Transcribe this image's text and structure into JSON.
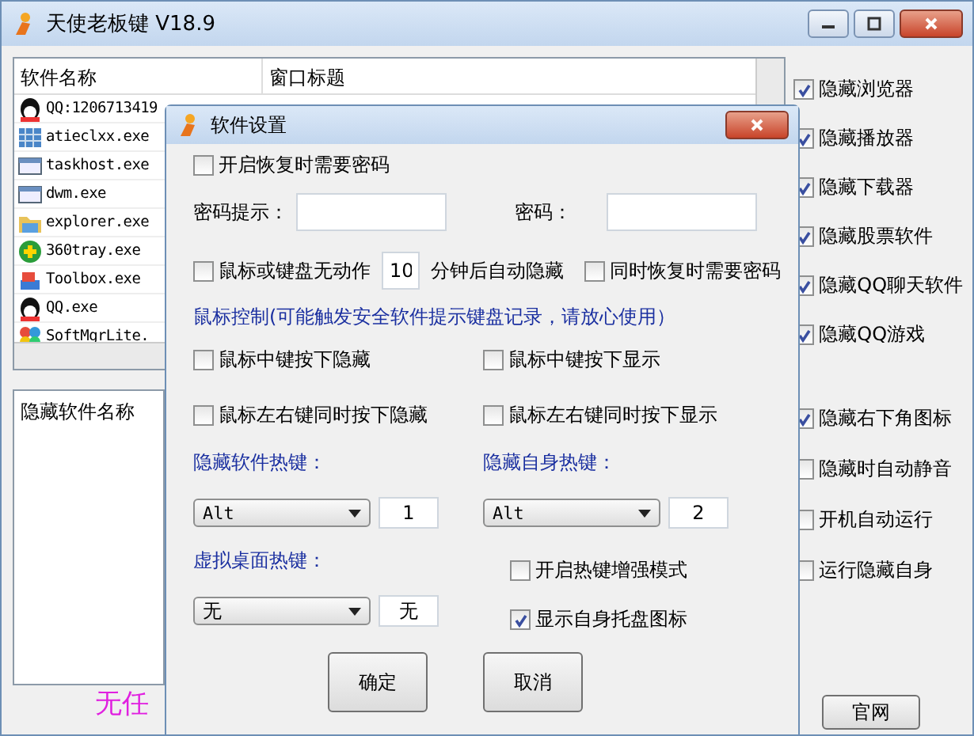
{
  "window": {
    "title": "天使老板键 V18.9"
  },
  "process_list": {
    "columns": [
      "软件名称",
      "窗口标题"
    ],
    "rows": [
      {
        "name": "QQ:1206713419",
        "kind": "penguin"
      },
      {
        "name": "atieclxx.exe",
        "kind": "grid"
      },
      {
        "name": "taskhost.exe",
        "kind": "window"
      },
      {
        "name": "dwm.exe",
        "kind": "window"
      },
      {
        "name": "explorer.exe",
        "kind": "folder"
      },
      {
        "name": "360tray.exe",
        "kind": "plus"
      },
      {
        "name": "Toolbox.exe",
        "kind": "boxes"
      },
      {
        "name": "QQ.exe",
        "kind": "penguin"
      },
      {
        "name": "SoftMgrLite.",
        "kind": "balls"
      }
    ]
  },
  "options": [
    {
      "label": "隐藏浏览器",
      "checked": true
    },
    {
      "label": "隐藏播放器",
      "checked": true
    },
    {
      "label": "隐藏下载器",
      "checked": true
    },
    {
      "label": "隐藏股票软件",
      "checked": true
    },
    {
      "label": "隐藏QQ聊天软件",
      "checked": true
    },
    {
      "label": "隐藏QQ游戏",
      "checked": true
    }
  ],
  "options_lower": [
    {
      "label": "隐藏右下角图标",
      "checked": true
    },
    {
      "label": "隐藏时自动静音",
      "checked": false
    },
    {
      "label": "开机自动运行",
      "checked": false
    },
    {
      "label": "运行隐藏自身",
      "checked": false
    }
  ],
  "hidden_list": {
    "columns": [
      "隐藏软件名称"
    ]
  },
  "status_text": "无任",
  "website_button": "官网",
  "dialog": {
    "title": "软件设置",
    "require_password": {
      "label": "开启恢复时需要密码",
      "checked": false
    },
    "password_hint": {
      "label": "密码提示："
    },
    "password": {
      "label": "密码："
    },
    "idle": {
      "label": "鼠标或键盘无动作",
      "checked": false,
      "minutes": "10",
      "suffix": "分钟后自动隐藏"
    },
    "idle_password": {
      "label": "同时恢复时需要密码",
      "checked": false
    },
    "mouse_heading": "鼠标控制(可能触发安全软件提示键盘记录，请放心使用）",
    "mouse_options": [
      {
        "label": "鼠标中键按下隐藏",
        "checked": false
      },
      {
        "label": "鼠标中键按下显示",
        "checked": false
      },
      {
        "label": "鼠标左右键同时按下隐藏",
        "checked": false
      },
      {
        "label": "鼠标左右键同时按下显示",
        "checked": false
      }
    ],
    "hotkeys": [
      {
        "label": "隐藏软件热键：",
        "modifier": "Alt",
        "key": "1"
      },
      {
        "label": "隐藏自身热键：",
        "modifier": "Alt",
        "key": "2"
      }
    ],
    "virtual_desktop": {
      "label": "虚拟桌面热键：",
      "modifier": "无",
      "key": "无"
    },
    "extra_options": [
      {
        "label": "开启热键增强模式",
        "checked": false
      },
      {
        "label": "显示自身托盘图标",
        "checked": true
      }
    ],
    "buttons": [
      "确定",
      "取消"
    ]
  }
}
